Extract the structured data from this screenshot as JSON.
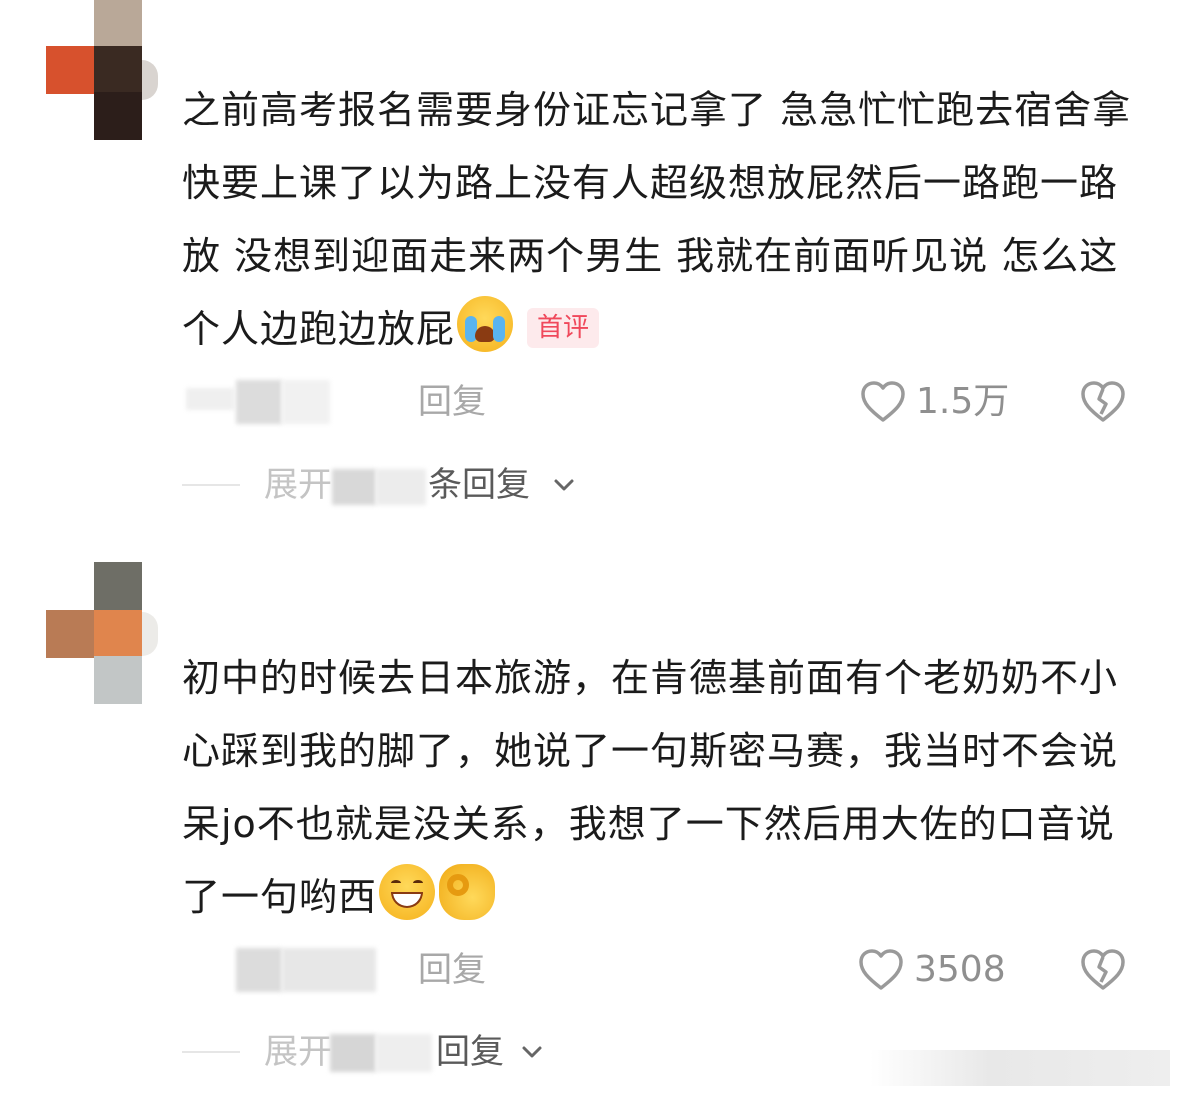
{
  "colors": {
    "text": "#1b1b1b",
    "meta_gray": "#a8a8a8",
    "count_gray": "#8f8f8f",
    "badge_bg": "#fdeaec",
    "badge_text": "#f0485b"
  },
  "comments": [
    {
      "body": "之前高考报名需要身份证忘记拿了 急急忙忙跑去宿舍拿 快要上课了以为路上没有人超级想放屁然后一路跑一路放 没想到迎面走来两个男生  我就在前面听见说 怎么这个人边跑边放屁",
      "emoji_names": [
        "loudly-crying-face-emoji"
      ],
      "badge": "首评",
      "reply_label": "回复",
      "like_count": "1.5万",
      "expand_prefix": "展开",
      "expand_suffix": "条回复"
    },
    {
      "body": "初中的时候去日本旅游，在肯德基前面有个老奶奶不小心踩到我的脚了，她说了一句斯密马赛，我当时不会说呆jo不也就是没关系，我想了一下然后用大佐的口音说了一句哟西",
      "emoji_names": [
        "grinning-face-emoji",
        "ok-hand-emoji"
      ],
      "reply_label": "回复",
      "like_count": "3508",
      "expand_prefix": "展开",
      "expand_suffix": "回复"
    }
  ]
}
